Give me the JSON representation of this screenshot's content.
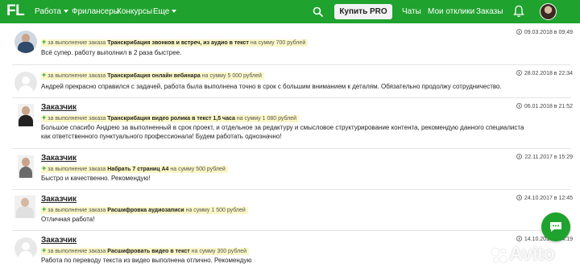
{
  "nav": {
    "logo": "FL",
    "work": "Работа",
    "freelancers": "Фрилансеры",
    "contests": "Конкурсы",
    "more": "Еще",
    "buy_pro": "Купить PRO",
    "chats": "Чаты",
    "my_responses": "Мои отклики",
    "orders": "Заказы"
  },
  "reviews": [
    {
      "author": "",
      "order_prefix": "за выполнение заказа",
      "order_title": "Транскрибация звонков и встреч, из аудио в текст",
      "sum_prefix": "на сумму",
      "price": "700 рублей",
      "date": "09.03.2018 в 09:49",
      "text": "Всё супер. работу выполнил в 2 раза быстрее."
    },
    {
      "author": "",
      "order_prefix": "за выполнение заказа",
      "order_title": "Транскрибация онлайн вебинара",
      "sum_prefix": "на сумму",
      "price": "5 000 рублей",
      "date": "28.02.2018 в 22:34",
      "text": "Андрей прекрасно справился с задачей, работа была выполнена точно в срок с большим вниманием к деталям. Обязательно продолжу сотрудничество."
    },
    {
      "author": "Заказчик",
      "order_prefix": "за выполнение заказа",
      "order_title": "Транскрибация видео ролика в текст 1,5 часа",
      "sum_prefix": "на сумму",
      "price": "1 080 рублей",
      "date": "06.01.2018 в 21:52",
      "text": "Большое спасибо Андрею за выполненный в срок проект, и отдельное за редактуру и смысловое структурирование контента, рекомендую данного специалиста как ответственного пунктуального профессионала! Будем работать однозначно!"
    },
    {
      "author": "Заказчик",
      "order_prefix": "за выполнение заказа",
      "order_title": "Набрать 7 страниц А4",
      "sum_prefix": "на сумму",
      "price": "500 рублей",
      "date": "22.11.2017 в 15:29",
      "text": "Быстро и качественно. Рекомендую!"
    },
    {
      "author": "Заказчик",
      "order_prefix": "за выполнение заказа",
      "order_title": "Расшифровка аудиозаписи",
      "sum_prefix": "на сумму",
      "price": "1 500 рублей",
      "date": "24.10.2017 в 12:45",
      "text": "Отличная работа!"
    },
    {
      "author": "Заказчик",
      "order_prefix": "за выполнение заказа",
      "order_title": "Расшифровать видео в текст",
      "sum_prefix": "на сумму",
      "price": "300 рублей",
      "date": "14.10.2017 в 14:19",
      "text": "Работа по переводу текста из видео выполнена отлично. Рекомендую"
    }
  ],
  "watermark": "Avito",
  "colors": {
    "brand_green": "#1fa22e",
    "order_highlight": "#fbf7c8"
  }
}
